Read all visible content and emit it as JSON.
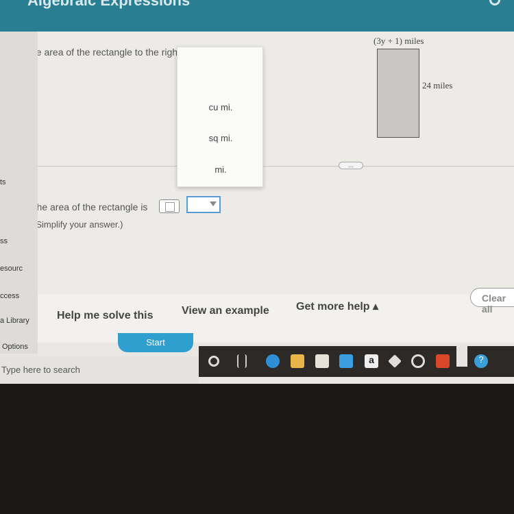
{
  "header": {
    "title": "Algebraic Expressions"
  },
  "sidebar": {
    "items": [
      "ts",
      "ss",
      "esourc",
      "ccess",
      "a Library",
      "Options"
    ]
  },
  "question": {
    "prompt": "Find the area of the rectangle to the right.",
    "width_label": "(3y + 1) miles",
    "height_label": "24 miles"
  },
  "more_label": "...",
  "answer": {
    "prefix": "The area of the rectangle is",
    "hint": "(Simplify your answer.)",
    "value": "",
    "unit_selected": ""
  },
  "dropdown": {
    "options": [
      "cu mi.",
      "sq mi.",
      "mi."
    ]
  },
  "helpbar": {
    "help_me": "Help me solve this",
    "example": "View an example",
    "more_help": "Get more help ▴",
    "clear": "Clear all"
  },
  "start": "Start",
  "taskbar": {
    "search_placeholder": "Type here to search",
    "icons": [
      "cortana-icon",
      "task-view-icon",
      "edge-icon",
      "file-explorer-icon",
      "store-icon",
      "mail-icon",
      "amazon-icon",
      "dropbox-icon",
      "app-icon",
      "office-icon",
      "help-icon"
    ]
  },
  "colors": {
    "header": "#2a7e91",
    "accent": "#2f9fd0"
  }
}
